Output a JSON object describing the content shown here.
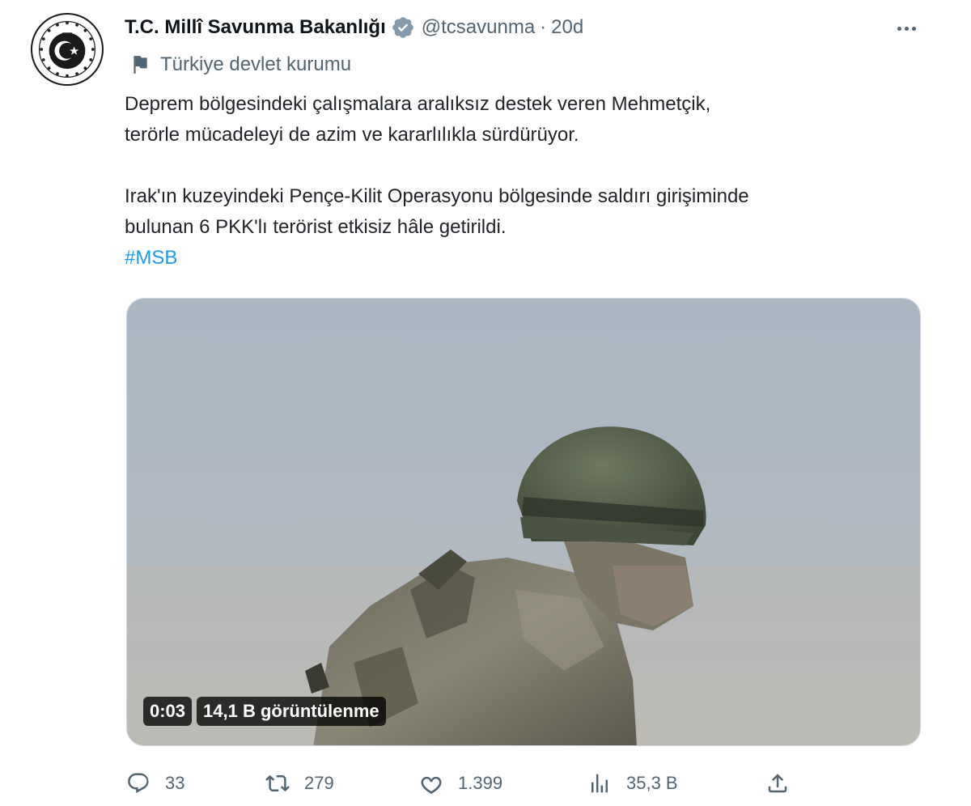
{
  "author": {
    "display_name": "T.C. Millî Savunma Bakanlığı",
    "handle": "@tcsavunma",
    "separator": "·",
    "time": "20d",
    "verified_badge": "verified-badge-icon",
    "affiliation": "Türkiye devlet kurumu"
  },
  "tweet": {
    "paragraph1_line1": "Deprem bölgesindeki çalışmalara aralıksız destek veren Mehmetçik,",
    "paragraph1_line2": "terörle mücadeleyi de azim ve kararlılıkla sürdürüyor.",
    "paragraph2_line1": "Irak'ın kuzeyindeki Pençe-Kilit Operasyonu bölgesinde saldırı girişiminde",
    "paragraph2_line2": "bulunan 6 PKK'lı terörist etkisiz hâle getirildi.",
    "hashtag": "#MSB"
  },
  "video": {
    "duration": "0:03",
    "views_label": "14,1 B görüntülenme"
  },
  "actions": {
    "replies": "33",
    "retweets": "279",
    "likes": "1.399",
    "views": "35,3 B"
  },
  "colors": {
    "accent": "#1d9bf0",
    "muted": "#536471",
    "text": "#0f1419"
  },
  "icons": [
    "avatar-emblem-icon",
    "verified-badge-icon",
    "more-icon",
    "flag-icon",
    "reply-icon",
    "retweet-icon",
    "like-icon",
    "views-icon",
    "share-icon"
  ]
}
